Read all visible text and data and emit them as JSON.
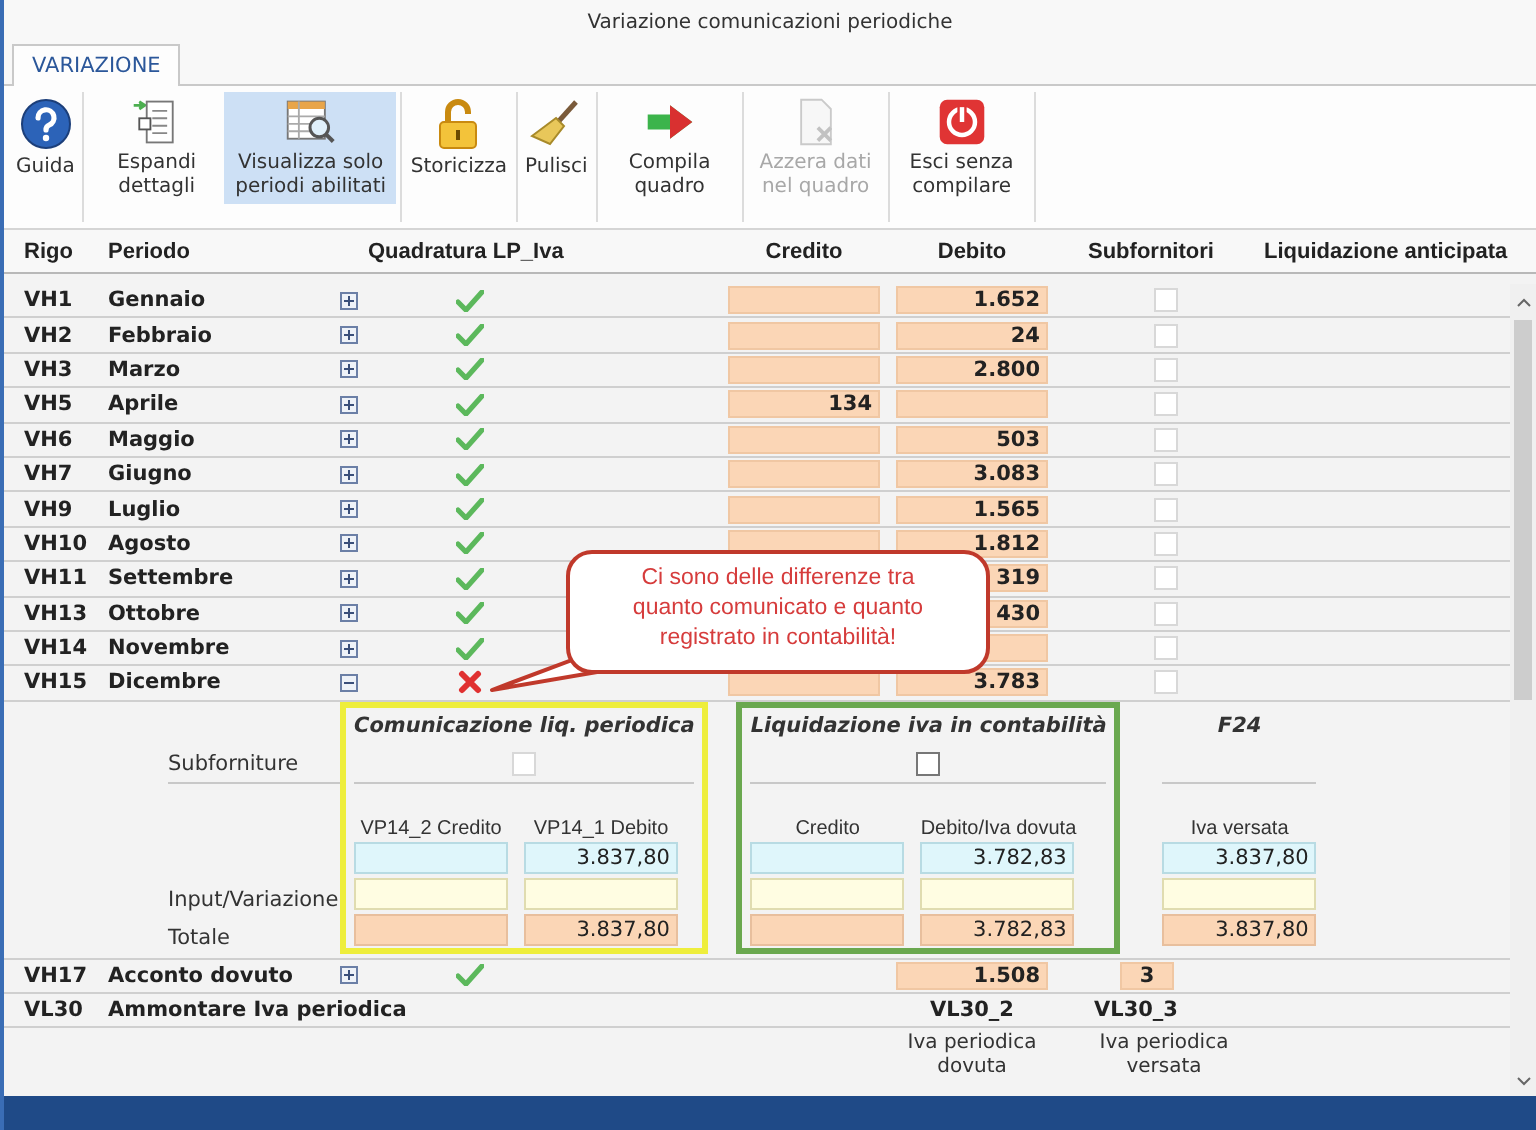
{
  "window": {
    "title": "Variazione comunicazioni periodiche"
  },
  "tabs": [
    {
      "label": "VARIAZIONE",
      "selected": true
    }
  ],
  "toolbar": {
    "groups": [
      [
        {
          "label": "Guida",
          "kind": "help",
          "selected": false,
          "disabled": false
        }
      ],
      [
        {
          "label": "Espandi dettagli",
          "kind": "expand",
          "selected": false,
          "disabled": false
        },
        {
          "label": "Visualizza solo periodi abilitati",
          "kind": "filter",
          "selected": true,
          "disabled": false
        }
      ],
      [
        {
          "label": "Storicizza",
          "kind": "lock",
          "selected": false,
          "disabled": false
        }
      ],
      [
        {
          "label": "Pulisci",
          "kind": "broom",
          "selected": false,
          "disabled": false
        }
      ],
      [
        {
          "label": "Compila quadro",
          "kind": "arrow",
          "selected": false,
          "disabled": false
        }
      ],
      [
        {
          "label": "Azzera dati nel quadro",
          "kind": "clear",
          "selected": false,
          "disabled": true
        }
      ],
      [
        {
          "label": "Esci senza compilare",
          "kind": "exit",
          "selected": false,
          "disabled": false
        }
      ]
    ]
  },
  "table": {
    "columns": [
      "Rigo",
      "Periodo",
      "Quadratura LP_Iva",
      "Credito",
      "Debito",
      "Subfornitori",
      "Liquidazione anticipata"
    ],
    "rows": [
      {
        "rigo": "VH1",
        "periodo": "Gennaio",
        "expanded": false,
        "ok": true,
        "debito": "1.652",
        "subfornitori": false
      },
      {
        "rigo": "VH2",
        "periodo": "Febbraio",
        "expanded": false,
        "ok": true,
        "debito": "24",
        "subfornitori": false
      },
      {
        "rigo": "VH3",
        "periodo": "Marzo",
        "expanded": false,
        "ok": true,
        "debito": "2.800",
        "subfornitori": false
      },
      {
        "rigo": "VH5",
        "periodo": "Aprile",
        "expanded": false,
        "ok": true,
        "credito": "134",
        "subfornitori": false
      },
      {
        "rigo": "VH6",
        "periodo": "Maggio",
        "expanded": false,
        "ok": true,
        "debito": "503",
        "subfornitori": false
      },
      {
        "rigo": "VH7",
        "periodo": "Giugno",
        "expanded": false,
        "ok": true,
        "debito": "3.083",
        "subfornitori": false
      },
      {
        "rigo": "VH9",
        "periodo": "Luglio",
        "expanded": false,
        "ok": true,
        "debito": "1.565",
        "subfornitori": false
      },
      {
        "rigo": "VH10",
        "periodo": "Agosto",
        "expanded": false,
        "ok": true,
        "debito": "1.812",
        "subfornitori": false
      },
      {
        "rigo": "VH11",
        "periodo": "Settembre",
        "expanded": false,
        "ok": true,
        "debito": "319",
        "subfornitori": false
      },
      {
        "rigo": "VH13",
        "periodo": "Ottobre",
        "expanded": false,
        "ok": true,
        "debito": "430",
        "subfornitori": false
      },
      {
        "rigo": "VH14",
        "periodo": "Novembre",
        "expanded": false,
        "ok": true,
        "subfornitori": false
      },
      {
        "rigo": "VH15",
        "periodo": "Dicembre",
        "expanded": true,
        "ok": false,
        "debito": "3.783",
        "subfornitori": false
      }
    ],
    "callout": "Ci sono delle differenze tra quanto comunicato e quanto registrato in contabilità!",
    "detail": {
      "subfornitura_label": "Subforniture",
      "rows": [
        {
          "kind": "base"
        },
        {
          "kind": "input",
          "label": "Input/Variazione"
        },
        {
          "kind": "total",
          "label": "Totale"
        }
      ],
      "groups": [
        {
          "title": "Comunicazione liq. periodica",
          "color": "#eeee3c",
          "checkbox": {
            "checked": false,
            "disabled": true
          },
          "columns": [
            {
              "label": "VP14_2 Credito"
            },
            {
              "label": "VP14_1 Debito",
              "values": {
                "base": "3.837,80",
                "total": "3.837,80"
              }
            }
          ]
        },
        {
          "title": "Liquidazione iva in contabilità",
          "color": "#6aa84f",
          "checkbox": {
            "checked": false,
            "disabled": false
          },
          "columns": [
            {
              "label": "Credito"
            },
            {
              "label": "Debito/Iva dovuta",
              "values": {
                "base": "3.782,83",
                "total": "3.782,83"
              }
            }
          ]
        },
        {
          "title": "F24",
          "columns": [
            {
              "label": "Iva versata",
              "values": {
                "base": "3.837,80",
                "total": "3.837,80"
              }
            }
          ]
        }
      ]
    },
    "acconto": {
      "rigo": "VH17",
      "periodo": "Acconto dovuto",
      "expanded": false,
      "ok": true,
      "debito": "1.508",
      "value_3": "3"
    },
    "ammontare": {
      "rigo": "VL30",
      "periodo": "Ammontare Iva periodica",
      "codes": [
        "VL30_2",
        "VL30_3"
      ],
      "captions": [
        "Iva periodica dovuta",
        "Iva periodica versata"
      ]
    }
  }
}
